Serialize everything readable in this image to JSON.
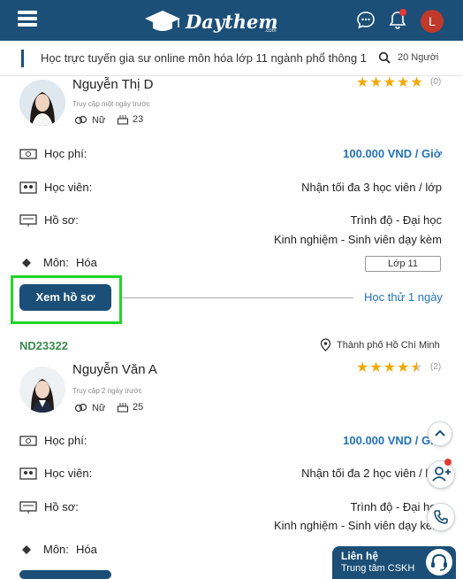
{
  "header": {
    "brand": "Daythem",
    "brand_suffix": ".com",
    "avatar_letter": "L"
  },
  "search": {
    "query": "Học trực tuyến gia sư online môn hóa lớp 11 ngành phổ thông 1",
    "result_count": "20 Người"
  },
  "tutors": [
    {
      "code": "",
      "name": "Nguyễn Thị D",
      "last_access": "Truy cập một ngày trước",
      "gender": "Nữ",
      "age": "23",
      "rating": 5,
      "review_count": "(0)",
      "fee_label": "Học phí:",
      "fee_value": "100.000 VND / Giờ",
      "students_label": "Học viên:",
      "students_value": "Nhận tối đa 3 học viên / lớp",
      "profile_label": "Hồ sơ:",
      "profile_level": "Trình độ - Đại học",
      "profile_exp": "Kinh nghiệm - Sinh viên dạy kèm",
      "subject_label": "Môn:",
      "subject_value": "Hóa",
      "grade": "Lớp 11",
      "view_button": "Xem hồ sơ",
      "trial": "Học thử 1 ngày"
    },
    {
      "code": "ND23322",
      "location": "Thành phố Hồ Chí Minh",
      "name": "Nguyễn Văn A",
      "last_access": "Truy cập 2 ngày trước",
      "gender": "Nữ",
      "age": "25",
      "rating": 4.5,
      "review_count": "(2)",
      "fee_label": "Học phí:",
      "fee_value": "100.000 VND / Giờ",
      "students_label": "Học viên:",
      "students_value": "Nhận tối đa 2 học viên / lớp",
      "profile_label": "Hồ sơ:",
      "profile_level": "Trình độ - Đại học",
      "profile_exp": "Kinh nghiệm - Sinh viên dạy kèm",
      "subject_label": "Môn:",
      "subject_value": "Hóa"
    }
  ],
  "support": {
    "title": "Liên hệ",
    "subtitle": "Trung tâm CSKH"
  },
  "colors": {
    "brand": "#1b4f77",
    "link": "#2373b8",
    "star": "#f2a900",
    "code": "#3a8a4c",
    "highlight": "#22d42a"
  }
}
